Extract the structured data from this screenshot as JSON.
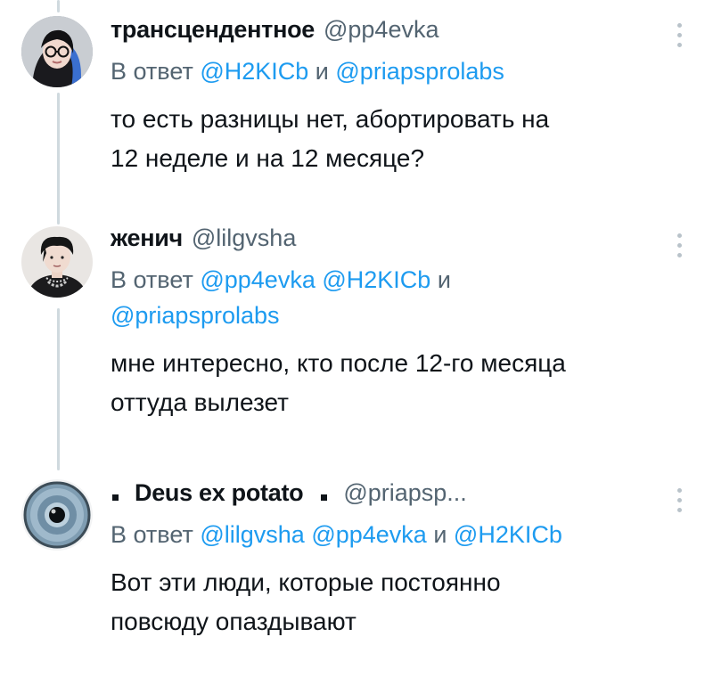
{
  "tweets": [
    {
      "name": "трансцендентное",
      "handle": "@pp4evka",
      "reply_prefix": "В ответ",
      "reply_line1": [
        {
          "text": "@H2KICb",
          "type": "mention"
        },
        {
          "text": " и ",
          "type": "plain"
        },
        {
          "text": "@priapsprolabs",
          "type": "mention"
        }
      ],
      "reply_line2": [],
      "text_lines": [
        "то есть разницы нет, абортировать на",
        "12 неделе и на 12 месяце?"
      ],
      "avatar_icon": "user-avatar-girl-glasses"
    },
    {
      "name": "женич",
      "handle": "@lilgvsha",
      "reply_prefix": "В ответ",
      "reply_line1": [
        {
          "text": "@pp4evka",
          "type": "mention"
        },
        {
          "text": " ",
          "type": "plain"
        },
        {
          "text": "@H2KICb",
          "type": "mention"
        },
        {
          "text": " и",
          "type": "plain"
        }
      ],
      "reply_line2": [
        {
          "text": "@priapsprolabs",
          "type": "mention"
        }
      ],
      "text_lines": [
        "мне интересно, кто после 12-го месяца",
        "оттуда вылезет"
      ],
      "avatar_icon": "user-avatar-boy-chain"
    },
    {
      "name": "Deus ex potato",
      "handle": "@priapsp...",
      "reply_prefix": "В ответ",
      "reply_line1": [
        {
          "text": "@lilgvsha",
          "type": "mention"
        },
        {
          "text": " ",
          "type": "plain"
        },
        {
          "text": "@pp4evka",
          "type": "mention"
        },
        {
          "text": " и ",
          "type": "plain"
        },
        {
          "text": "@H2KICb",
          "type": "mention"
        }
      ],
      "reply_line2": [],
      "text_lines": [
        "Вот эти люди, которые постоянно",
        "повсюду опаздывают"
      ],
      "avatar_icon": "user-avatar-eye"
    }
  ],
  "icons": {
    "more": "more-vertical-icon"
  },
  "colors": {
    "mention": "#1d9bf0",
    "secondary": "#536471",
    "thread_line": "#cfd9de"
  }
}
